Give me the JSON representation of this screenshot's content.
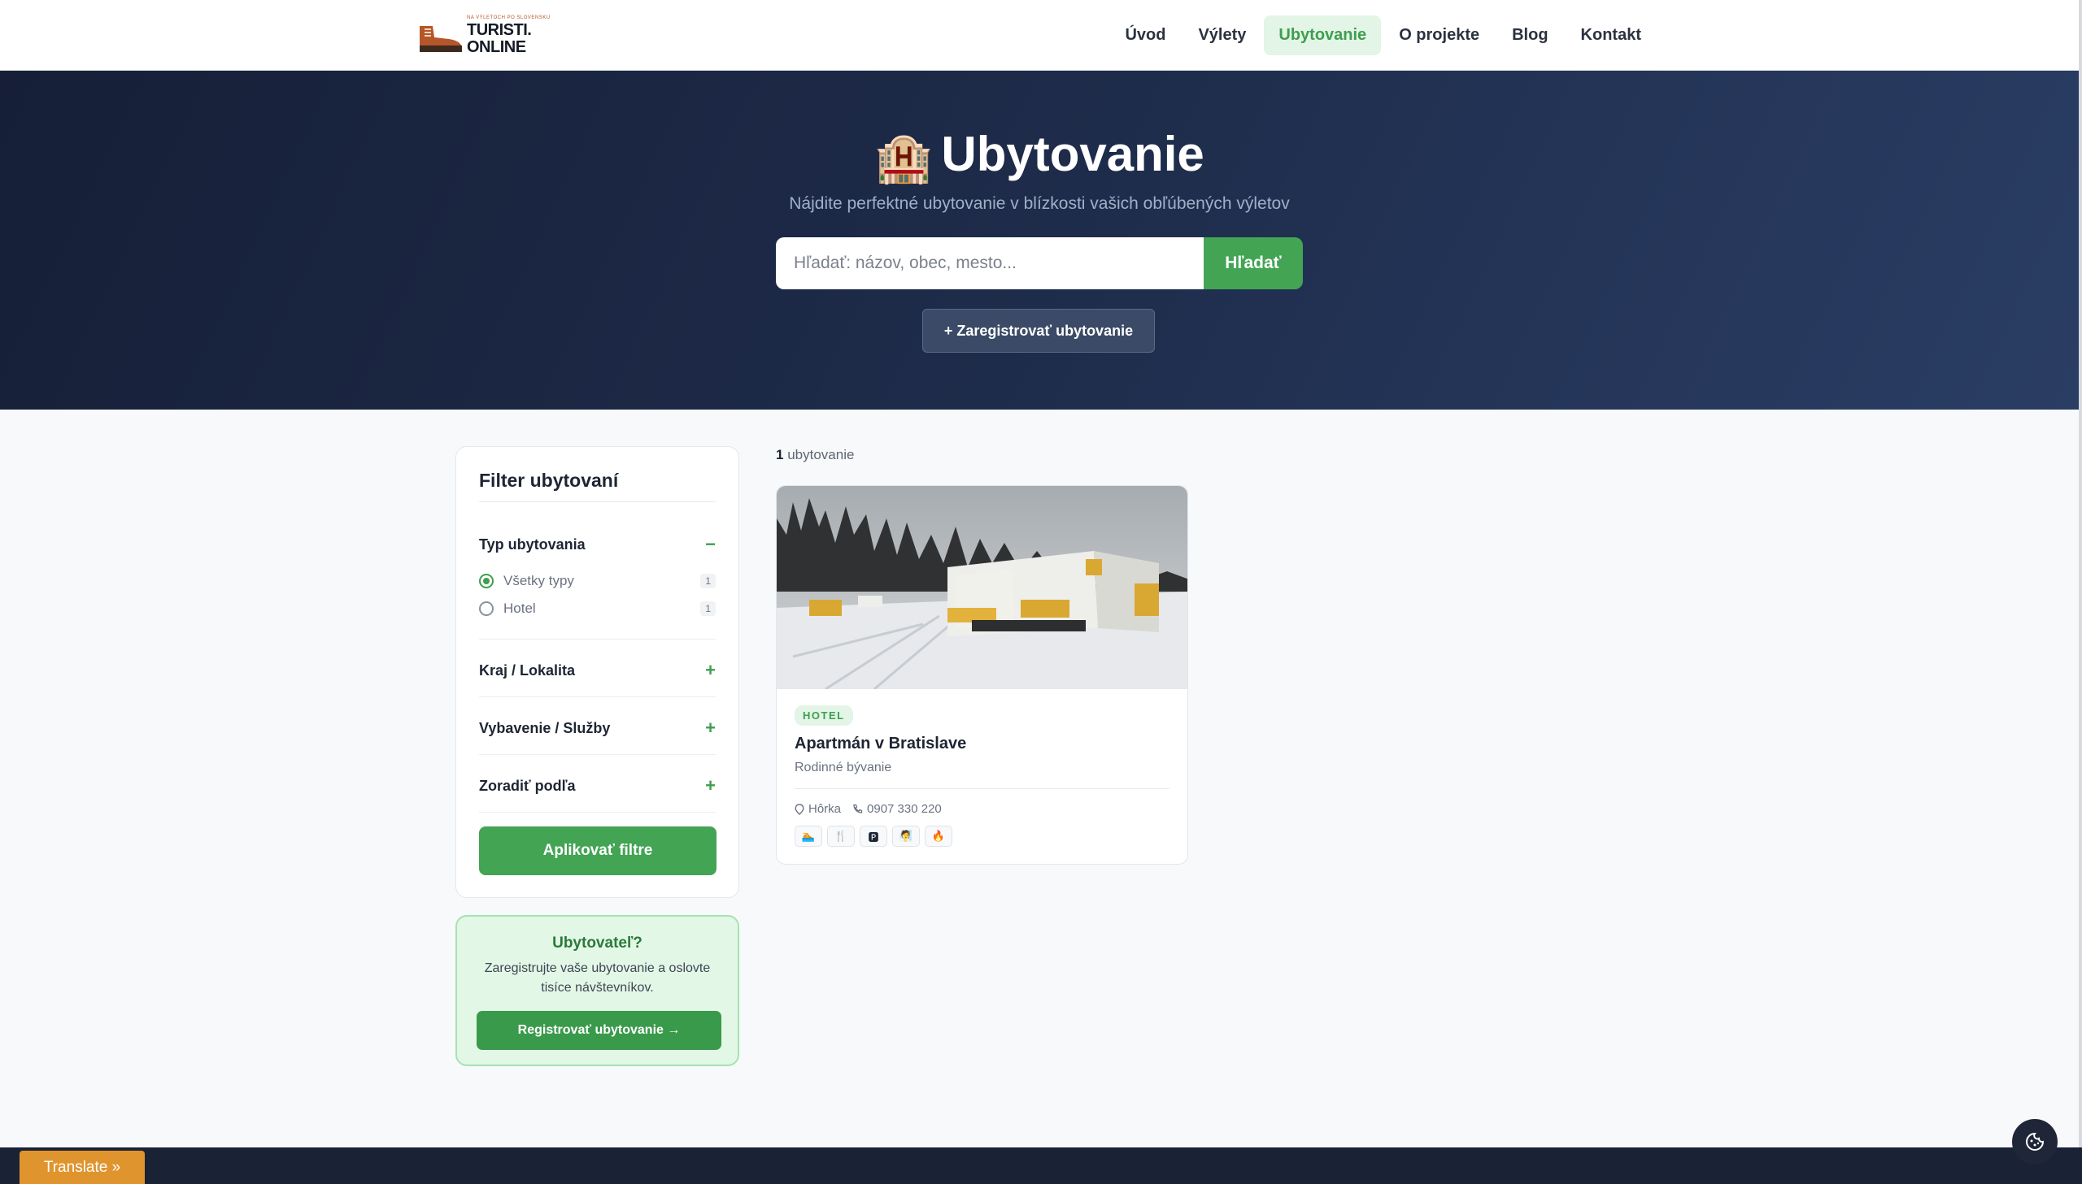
{
  "header": {
    "logo_small": "NA VÝLETOCH PO SLOVENSKU",
    "logo_line1": "TURISTI.",
    "logo_line2": "ONLINE",
    "nav": [
      "Úvod",
      "Výlety",
      "Ubytovanie",
      "O projekte",
      "Blog",
      "Kontakt"
    ],
    "active_nav": "Ubytovanie"
  },
  "hero": {
    "emoji": "🏨",
    "title": "Ubytovanie",
    "subtitle": "Nájdite perfektné ubytovanie v blízkosti vašich obľúbených výletov",
    "search_placeholder": "Hľadať: názov, obec, mesto...",
    "search_button": "Hľadať",
    "register_button": "+ Zaregistrovať ubytovanie"
  },
  "filter": {
    "title": "Filter ubytovaní",
    "section_type": "Typ ubytovania",
    "section_type_toggle": "−",
    "options": [
      {
        "label": "Všetky typy",
        "count": "1",
        "selected": true
      },
      {
        "label": "Hotel",
        "count": "1",
        "selected": false
      }
    ],
    "section_region": "Kraj / Lokalita",
    "section_amenities": "Vybavenie / Služby",
    "section_sort": "Zoradiť podľa",
    "toggle_plus": "+",
    "apply_button": "Aplikovať filtre"
  },
  "promo": {
    "title": "Ubytovateľ?",
    "text": "Zaregistrujte vaše ubytovanie a oslovte tisíce návštevníkov.",
    "button": "Registrovať ubytovanie →"
  },
  "results": {
    "count_number": "1",
    "count_label": " ubytovanie",
    "card": {
      "badge": "HOTEL",
      "title": "Apartmán v Bratislave",
      "subtitle": "Rodinné bývanie",
      "location": "Hôrka",
      "phone": "0907 330 220",
      "amenities": [
        "🏊",
        "🍴",
        "🅿",
        "🧖",
        "🔥"
      ]
    }
  },
  "footer": {
    "translate": "Translate »"
  }
}
